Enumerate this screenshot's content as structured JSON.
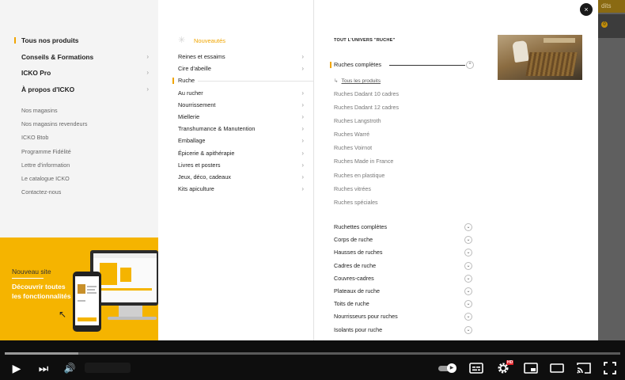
{
  "background_bar_text": "dits",
  "background_badge": "0",
  "close_label": "×",
  "main_nav": {
    "items": [
      {
        "label": "Tous nos produits",
        "chevron": ""
      },
      {
        "label": "Conseils & Formations",
        "chevron": "›"
      },
      {
        "label": "ICKO Pro",
        "chevron": "›"
      },
      {
        "label": "À propos d'ICKO",
        "chevron": "›"
      }
    ],
    "secondary": [
      "Nos magasins",
      "Nos magasins revendeurs",
      "ICKO Btob",
      "Programme Fidélité",
      "Lettre d'information",
      "Le catalogue ICKO",
      "Contactez-nous"
    ]
  },
  "promo": {
    "title": "Nouveau site",
    "subtitle": "Découvrir toutes les fonctionnalités !",
    "cursor": "↖"
  },
  "categories": {
    "new_icon": "✳",
    "new_label": "Nouveautés",
    "items": [
      {
        "label": "Reines et essaims",
        "chevron": "›"
      },
      {
        "label": "Cire d'abeille",
        "chevron": "›"
      },
      {
        "label": "Ruche",
        "chevron": ""
      },
      {
        "label": "Au rucher",
        "chevron": "›"
      },
      {
        "label": "Nourrissement",
        "chevron": "›"
      },
      {
        "label": "Miellerie",
        "chevron": "›"
      },
      {
        "label": "Transhumance & Manutention",
        "chevron": "›"
      },
      {
        "label": "Emballage",
        "chevron": "›"
      },
      {
        "label": "Épicerie & apithérapie",
        "chevron": "›"
      },
      {
        "label": "Livres et posters",
        "chevron": "›"
      },
      {
        "label": "Jeux, déco, cadeaux",
        "chevron": "›"
      },
      {
        "label": "Kits apiculture",
        "chevron": "›"
      }
    ]
  },
  "ruche": {
    "universe_label": "TOUT L'UNIVERS \"RUCHE\"",
    "section_title": "Ruches complètes",
    "section_toggle": "^",
    "all_products_arrow": "↳",
    "all_products": "Tous les produits",
    "subitems": [
      "Ruches Dadant 10 cadres",
      "Ruches Dadant 12 cadres",
      "Ruches Langstroth",
      "Ruches Warré",
      "Ruches Voirnot",
      "Ruches Made in France",
      "Ruches en plastique",
      "Ruches vitrées",
      "Ruches spéciales"
    ],
    "accordion_toggle": "⌄",
    "accordions": [
      "Ruchettes complètes",
      "Corps de ruche",
      "Hausses de ruches",
      "Cadres de ruche",
      "Couvres-cadres",
      "Plateaux de ruche",
      "Toits de ruche",
      "Nourrisseurs pour ruches",
      "Isolants pour ruche"
    ]
  },
  "player": {
    "buffered_fraction": 0.12,
    "play": "▶",
    "next": "⏭",
    "volume": "🔊",
    "hd_badge": "HD"
  }
}
